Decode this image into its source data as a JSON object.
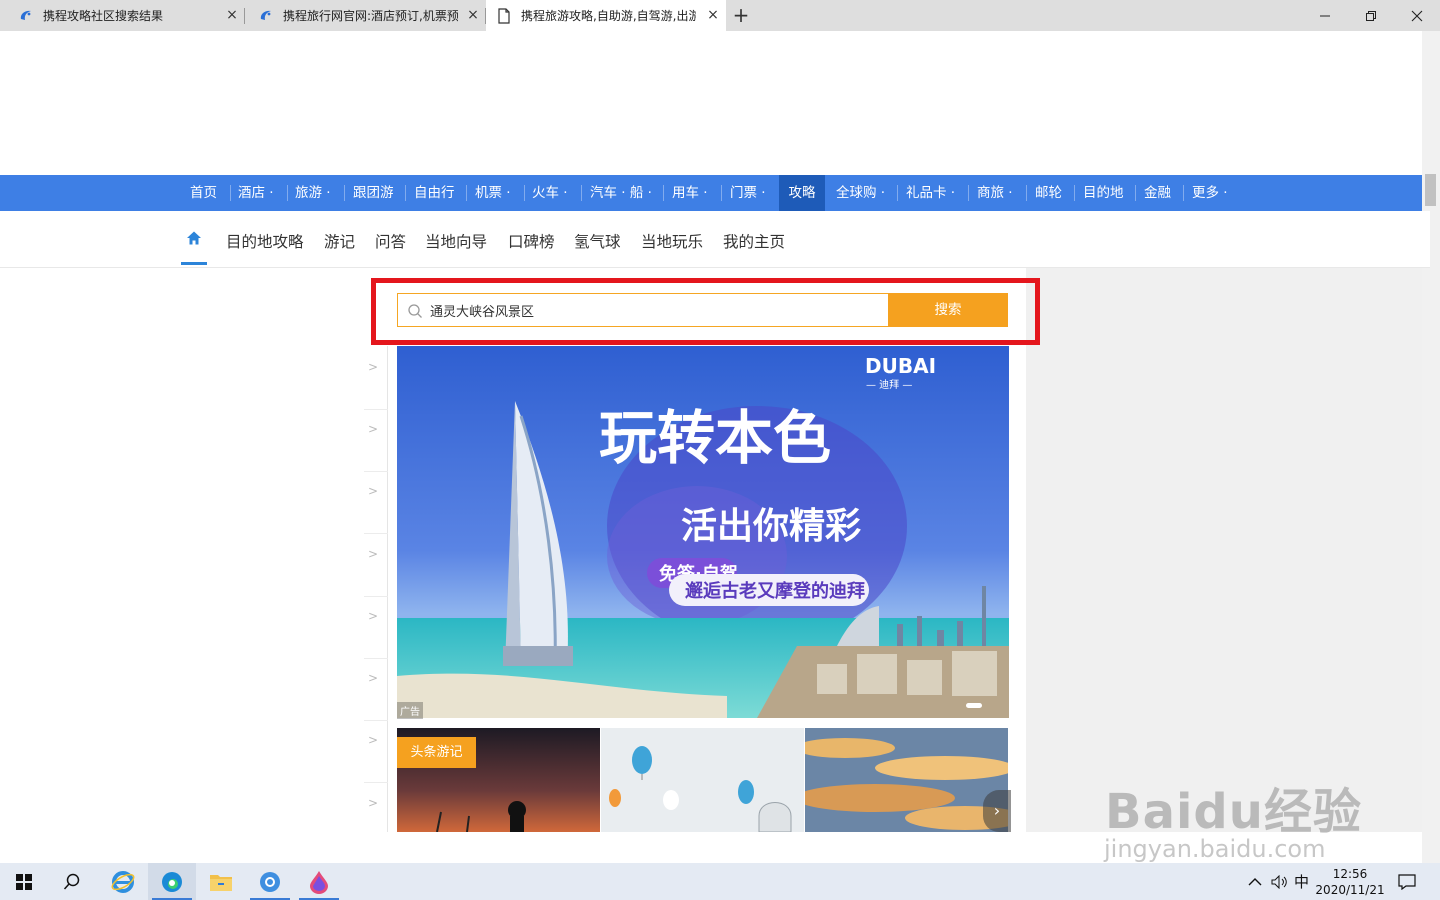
{
  "browser": {
    "tabs": [
      {
        "title": "携程攻略社区搜索结果",
        "active": false
      },
      {
        "title": "携程旅行网官网:酒店预订,机票预",
        "active": false
      },
      {
        "title": "携程旅游攻略,自助游,自驾游,出游",
        "active": true
      }
    ]
  },
  "main_nav": {
    "items": [
      "首页",
      "酒店 ·",
      "旅游 ·",
      "跟团游",
      "自由行",
      "机票 ·",
      "火车 ·",
      "汽车 · 船 ·",
      "用车 ·",
      "门票 ·",
      "攻略",
      "全球购 ·",
      "礼品卡 ·",
      "商旅 ·",
      "邮轮",
      "目的地",
      "金融",
      "更多 ·"
    ],
    "active": "攻略"
  },
  "sub_nav": {
    "items": [
      "目的地攻略",
      "游记",
      "问答",
      "当地向导",
      "口碑榜",
      "氢气球",
      "当地玩乐",
      "我的主页"
    ]
  },
  "search": {
    "value": "通灵大峡谷风景区",
    "button_label": "搜索"
  },
  "banner": {
    "brand": "DUBAI",
    "brand_sub": "— 迪拜 —",
    "headline": "玩转本色",
    "subheadline": "活出你精彩",
    "pill_line1": "免签·自驾",
    "pill_line2": "邂逅古老又摩登的迪拜",
    "ad_tag": "广告"
  },
  "travelogue": {
    "badge": "头条游记"
  },
  "watermark": {
    "logo": "Baidu经验",
    "url": "jingyan.baidu.com"
  },
  "taskbar": {
    "ime": "中",
    "time": "12:56",
    "date": "2020/11/21"
  },
  "colors": {
    "nav_blue": "#3e7fe5",
    "nav_active": "#1e5bb8",
    "search_orange": "#f5a11f",
    "highlight_red": "#e4161d"
  }
}
